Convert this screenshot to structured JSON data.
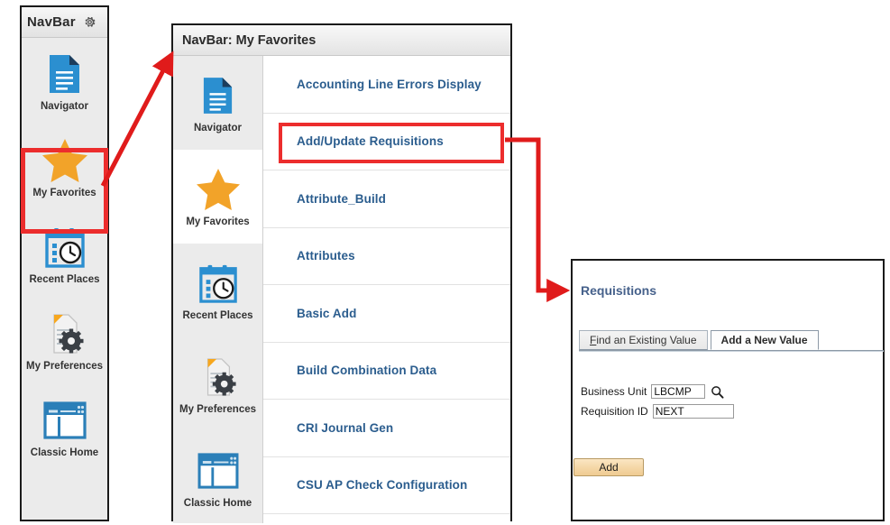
{
  "navbar": {
    "title": "NavBar",
    "gear_icon": "gear-icon",
    "items": [
      {
        "label": "Navigator",
        "icon": "document-icon"
      },
      {
        "label": "My Favorites",
        "icon": "star-icon"
      },
      {
        "label": "Recent Places",
        "icon": "calendar-clock-icon"
      },
      {
        "label": "My Preferences",
        "icon": "document-gear-icon"
      },
      {
        "label": "Classic Home",
        "icon": "browser-window-icon"
      }
    ]
  },
  "favorites": {
    "header_title": "NavBar: My Favorites",
    "rail_items": [
      {
        "label": "Navigator",
        "icon": "document-icon",
        "selected": false
      },
      {
        "label": "My Favorites",
        "icon": "star-icon",
        "selected": true
      },
      {
        "label": "Recent Places",
        "icon": "calendar-clock-icon",
        "selected": false
      },
      {
        "label": "My Preferences",
        "icon": "document-gear-icon",
        "selected": false
      },
      {
        "label": "Classic Home",
        "icon": "browser-window-icon",
        "selected": false
      }
    ],
    "menu_items": [
      {
        "label": "Accounting Line Errors Display"
      },
      {
        "label": "Add/Update Requisitions"
      },
      {
        "label": "Attribute_Build"
      },
      {
        "label": "Attributes"
      },
      {
        "label": "Basic Add"
      },
      {
        "label": "Build Combination Data"
      },
      {
        "label": "CRI Journal Gen"
      },
      {
        "label": "CSU AP Check Configuration"
      }
    ]
  },
  "requisitions": {
    "title": "Requisitions",
    "tabs": [
      {
        "label": "Find an Existing Value",
        "active": false,
        "accel": "F"
      },
      {
        "label": "Add a New Value",
        "active": true,
        "accel": ""
      }
    ],
    "fields": [
      {
        "label": "Business Unit",
        "value": "LBCMP",
        "has_lookup": true,
        "lookup_icon": "magnifier-icon"
      },
      {
        "label": "Requisition ID",
        "value": "NEXT",
        "has_lookup": false,
        "lookup_icon": ""
      }
    ],
    "add_label": "Add"
  },
  "annotations": {
    "highlight_color": "#ec2d2d",
    "arrow_color": "#e01b1b",
    "highlighted_nav_item": "My Favorites",
    "highlighted_menu_item": "Add/Update Requisitions"
  },
  "colors": {
    "link_blue": "#2b5d8e",
    "icon_blue": "#2b8fd0",
    "star_orange": "#f2a329",
    "panel_bg": "#ebebeb",
    "add_button": "#f5d8a8"
  }
}
